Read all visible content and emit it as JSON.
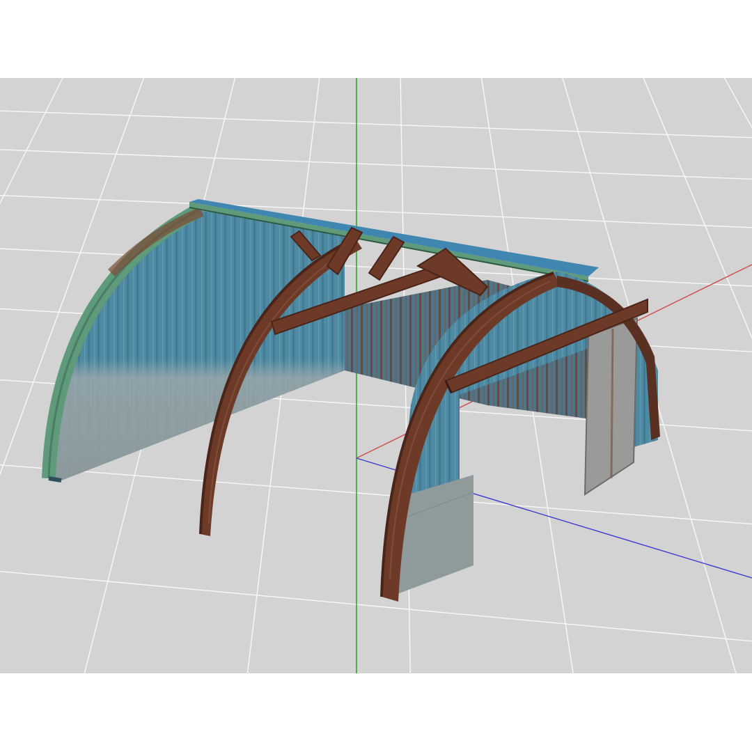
{
  "viewport": {
    "background": "#d3d3d3",
    "grid_color": "#ffffff",
    "axes": {
      "x_axis_color": "#d24a4a",
      "y_axis_color": "#2fa82f",
      "z_axis_color": "#3a3ad0"
    }
  },
  "model": {
    "type": "quonset-hut-frame",
    "colors": {
      "panel_blue": "#4f8aa3",
      "panel_blue_dark": "#3c6f86",
      "panel_weathered": "#8e9a9c",
      "rusty_beam": "#6e3a28",
      "rusty_beam_dark": "#4a2418",
      "green_trim": "#5f9a7a",
      "ridge_blue": "#3f86b0",
      "door_panel": "#9a9a98"
    }
  }
}
